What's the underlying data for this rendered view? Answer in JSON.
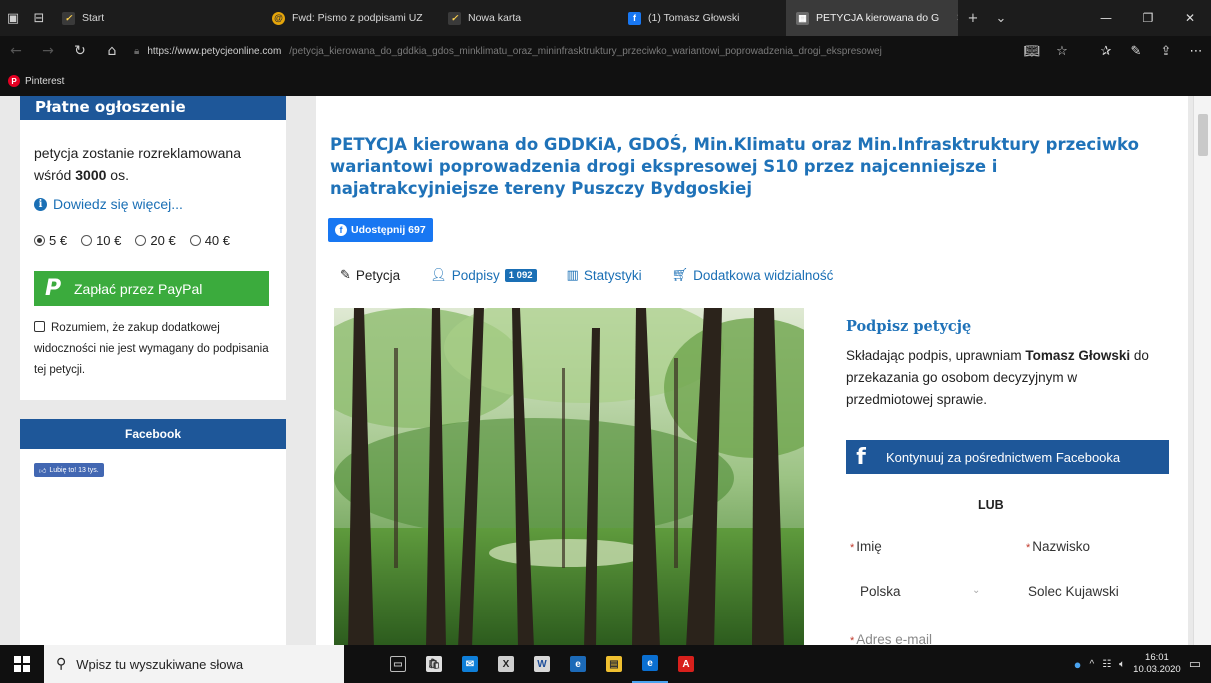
{
  "browser": {
    "tabs": [
      {
        "label": "Start",
        "icon": "start-icon"
      },
      {
        "label": "Fwd: Pismo z podpisami UZ",
        "icon": "mail-icon"
      },
      {
        "label": "Nowa karta",
        "icon": "new-tab-icon"
      },
      {
        "label": "(1) Tomasz Głowski",
        "icon": "facebook-icon"
      },
      {
        "label": "PETYCJA kierowana do G",
        "icon": "petition-icon",
        "active": true
      }
    ],
    "url_host": "https://www.petycjeonline.com",
    "url_path": "/petycja_kierowana_do_gddkia_gdos_minklimatu_oraz_mininfrasktruktury_przeciwko_wariantowi_poprowadzenia_drogi_ekspresowej",
    "favorites": [
      {
        "label": "Pinterest",
        "icon": "pinterest-icon"
      }
    ]
  },
  "sidebar": {
    "promo": {
      "title": "Płatne ogłoszenie",
      "text_prefix": "petycja zostanie rozreklamowana wśród",
      "count": "3000",
      "text_suffix": "os.",
      "learn_more": "Dowiedz się więcej...",
      "prices": [
        {
          "label": "5 €",
          "selected": true
        },
        {
          "label": "10 €",
          "selected": false
        },
        {
          "label": "20 €",
          "selected": false
        },
        {
          "label": "40 €",
          "selected": false
        }
      ],
      "paypal_button": "Zapłać przez PayPal",
      "consent": "Rozumiem, że zakup dodatkowej widoczności nie jest wymagany do podpisania tej petycji."
    },
    "facebook": {
      "title": "Facebook",
      "like_button": "Lubię to! 13 tys."
    }
  },
  "petition": {
    "title": "PETYCJA kierowana do GDDKiA, GDOŚ, Min.Klimatu oraz Min.Infrasktruktury przeciwko wariantowi poprowadzenia drogi ekspresowej S10 przez najcenniejsze i najatrakcyjniejsze tereny Puszczy Bydgoskiej",
    "share_button": "Udostępnij 697",
    "tabs": [
      {
        "label": "Petycja",
        "icon": "pencil-icon",
        "active": true
      },
      {
        "label": "Podpisy",
        "icon": "user-icon",
        "badge": "1 092"
      },
      {
        "label": "Statystyki",
        "icon": "bar-chart-icon"
      },
      {
        "label": "Dodatkowa widzialność",
        "icon": "cart-icon"
      }
    ]
  },
  "sign_form": {
    "title": "Podpisz petycję",
    "desc_prefix": "Składając podpis, uprawniam",
    "author": "Tomasz Głowski",
    "desc_suffix": "do przekazania go osobom decyzyjnym w przedmiotowej sprawie.",
    "facebook_button": "Kontynuuj za pośrednictwem Facebooka",
    "or_label": "LUB",
    "first_name_placeholder": "Imię",
    "last_name_placeholder": "Nazwisko",
    "country_value": "Polska",
    "city_value": "Solec Kujawski",
    "email_placeholder": "Adres e-mail"
  },
  "taskbar": {
    "search_placeholder": "Wpisz tu wyszukiwane słowa",
    "time": "16:01",
    "date": "10.03.2020"
  },
  "colors": {
    "accent_blue": "#1e5799",
    "title_blue": "#1f72b8",
    "paypal_green": "#3bab3d",
    "facebook_blue": "#1877f2"
  }
}
